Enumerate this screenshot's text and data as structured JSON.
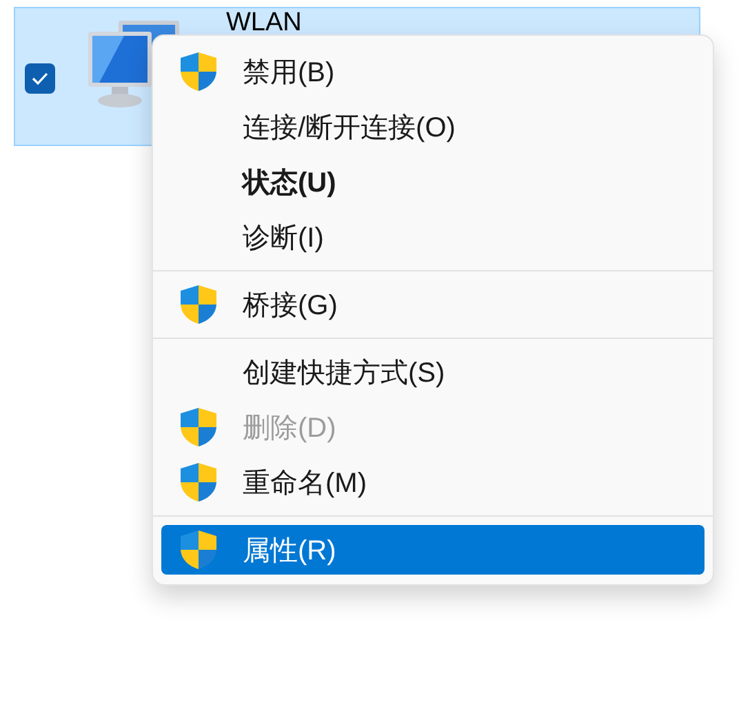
{
  "adapter": {
    "name": "WLAN",
    "selected": true,
    "checked": true
  },
  "context_menu": {
    "groups": [
      {
        "items": [
          {
            "label": "禁用(B)",
            "shield": true,
            "bold": false,
            "disabled": false,
            "selected": false
          },
          {
            "label": "连接/断开连接(O)",
            "shield": false,
            "bold": false,
            "disabled": false,
            "selected": false
          },
          {
            "label": "状态(U)",
            "shield": false,
            "bold": true,
            "disabled": false,
            "selected": false
          },
          {
            "label": "诊断(I)",
            "shield": false,
            "bold": false,
            "disabled": false,
            "selected": false
          }
        ]
      },
      {
        "items": [
          {
            "label": "桥接(G)",
            "shield": true,
            "bold": false,
            "disabled": false,
            "selected": false
          }
        ]
      },
      {
        "items": [
          {
            "label": "创建快捷方式(S)",
            "shield": false,
            "bold": false,
            "disabled": false,
            "selected": false
          },
          {
            "label": "删除(D)",
            "shield": true,
            "bold": false,
            "disabled": true,
            "selected": false
          },
          {
            "label": "重命名(M)",
            "shield": true,
            "bold": false,
            "disabled": false,
            "selected": false
          }
        ]
      },
      {
        "items": [
          {
            "label": "属性(R)",
            "shield": true,
            "bold": false,
            "disabled": false,
            "selected": true
          }
        ]
      }
    ]
  }
}
